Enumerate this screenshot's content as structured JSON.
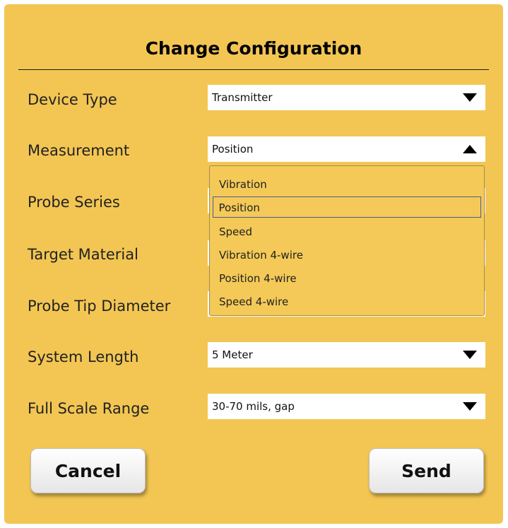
{
  "dialog": {
    "title": "Change Configuration"
  },
  "fields": [
    {
      "label": "Device Type",
      "value": "Transmitter"
    },
    {
      "label": "Measurement",
      "value": "Position"
    },
    {
      "label": "Probe Series",
      "value": ""
    },
    {
      "label": "Target Material",
      "value": ""
    },
    {
      "label": "Probe Tip Diameter",
      "value": ""
    },
    {
      "label": "System Length",
      "value": "5 Meter"
    },
    {
      "label": "Full Scale Range",
      "value": "30-70 mils, gap"
    }
  ],
  "measurement_dropdown": {
    "options": [
      "Vibration",
      "Position",
      "Speed",
      "Vibration 4-wire",
      "Position 4-wire",
      "Speed 4-wire"
    ],
    "selected": "Position"
  },
  "buttons": {
    "cancel": "Cancel",
    "send": "Send"
  },
  "icons": {
    "collapsed": "triangle-down-icon",
    "expanded": "triangle-up-icon"
  },
  "colors": {
    "background": "#f3c653",
    "selection_border": "#4a5a9c"
  }
}
